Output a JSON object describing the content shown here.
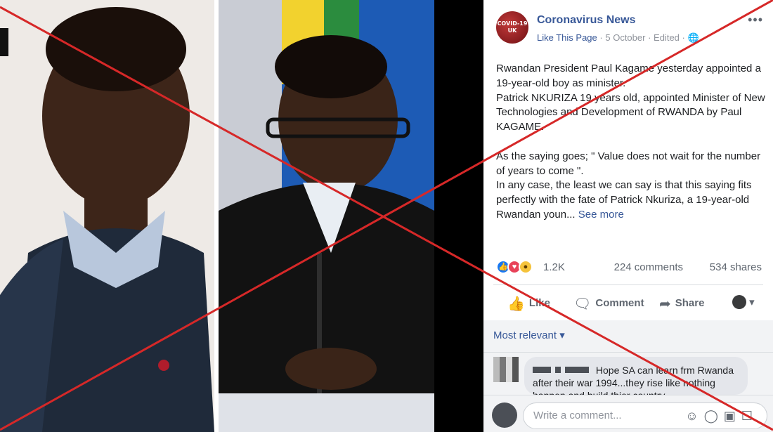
{
  "post": {
    "page_name": "Coronavirus News",
    "avatar_text": "COVID-19",
    "avatar_subtext": "UK",
    "meta": {
      "like_page": "Like This Page",
      "date": "5 October",
      "edited": "Edited",
      "separator": "·"
    },
    "more_icon": "ellipsis-icon",
    "text_paragraphs": [
      "Rwandan President Paul Kagame yesterday appointed a 19-year-old boy as minister.",
      "Patrick NKURIZA 19 years old, appointed Minister of New Technologies and Development of RWANDA by Paul KAGAME.",
      "",
      "As the saying goes; \" Value does not wait for the number of years to come \".",
      "In any case, the least we can say is that this saying fits perfectly with the fate of Patrick Nkuriza, a 19-year-old Rwandan youn..."
    ],
    "see_more": "See more",
    "reactions": {
      "count": "1.2K",
      "comments": "224 comments",
      "shares": "534 shares",
      "icons": [
        "like-icon",
        "love-icon",
        "wow-icon"
      ]
    },
    "actions": {
      "like": "Like",
      "comment": "Comment",
      "share": "Share"
    },
    "sort_label": "Most relevant ▾",
    "comment": {
      "text_visible": "Hope SA can learn frm Rwanda after their war 1994...they rise like",
      "text_cut": "nothing happen and build thier country"
    },
    "composer_placeholder": "Write a comment...",
    "colors": {
      "link": "#385898",
      "muted": "#90949c",
      "cross": "#d62828"
    }
  }
}
